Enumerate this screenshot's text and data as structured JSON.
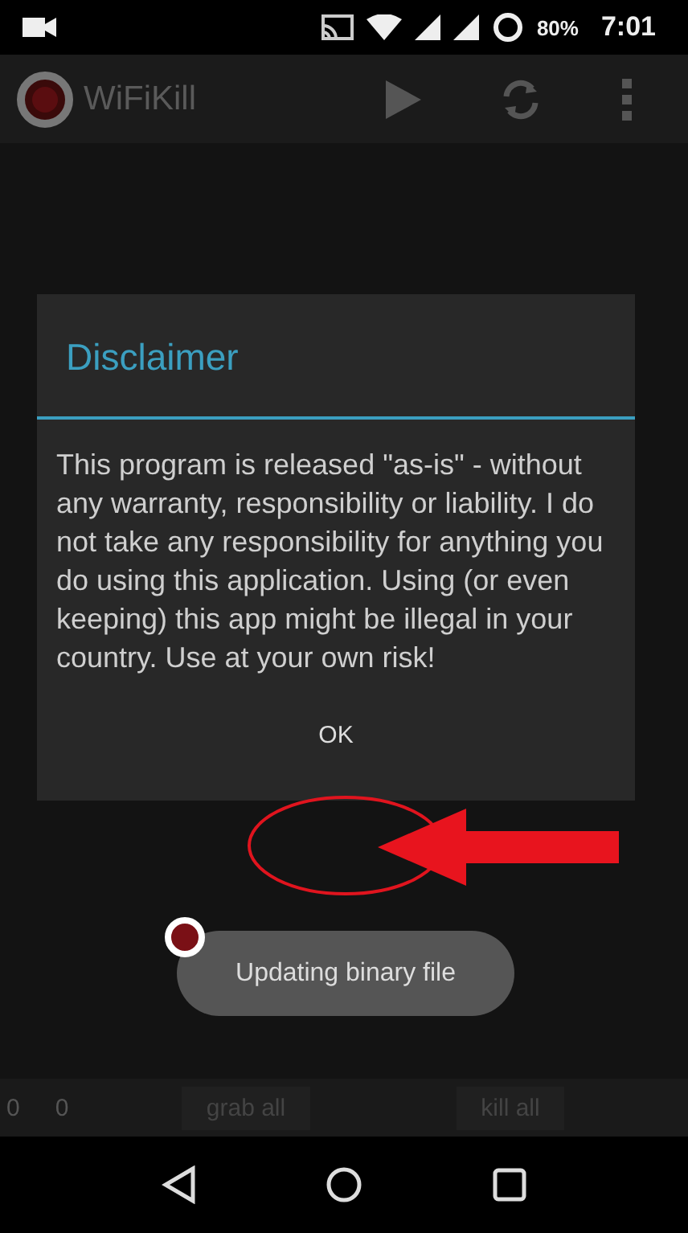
{
  "status_bar": {
    "battery": "80%",
    "time": "7:01"
  },
  "app_bar": {
    "title": "WiFiKill"
  },
  "dialog": {
    "title": "Disclaimer",
    "message": "This program is released \"as-is\" - without any warranty, responsibility or liability. I do not take any responsibility for anything you do using this application. Using (or even keeping) this app might be illegal in your country. Use at your own risk!",
    "button": "OK"
  },
  "toast": {
    "text": "Updating binary file"
  },
  "bottom_bar": {
    "counts": [
      "0",
      "0"
    ],
    "buttons": [
      "grab all",
      "kill all"
    ]
  }
}
